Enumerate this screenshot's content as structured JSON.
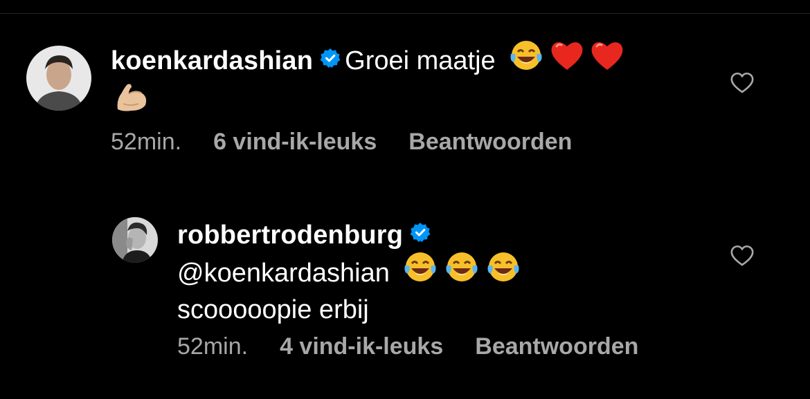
{
  "comments": [
    {
      "username": "koenkardashian",
      "text": "Groei maatje",
      "emojis": [
        "face-with-tears-of-joy",
        "red-heart",
        "red-heart",
        "flexed-biceps"
      ],
      "time": "52min.",
      "likes": "6 vind-ik-leuks",
      "reply_label": "Beantwoorden"
    },
    {
      "username": "robbertrodenburg",
      "mention": "@koenkardashian",
      "emojis": [
        "face-with-tears-of-joy",
        "face-with-tears-of-joy",
        "face-with-tears-of-joy"
      ],
      "text_line2": "scooooopie erbij",
      "time": "52min.",
      "likes": "4 vind-ik-leuks",
      "reply_label": "Beantwoorden"
    }
  ],
  "colors": {
    "background": "#000000",
    "primary_text": "#ffffff",
    "secondary_text": "#a8a8a8",
    "verified": "#0095f6"
  }
}
